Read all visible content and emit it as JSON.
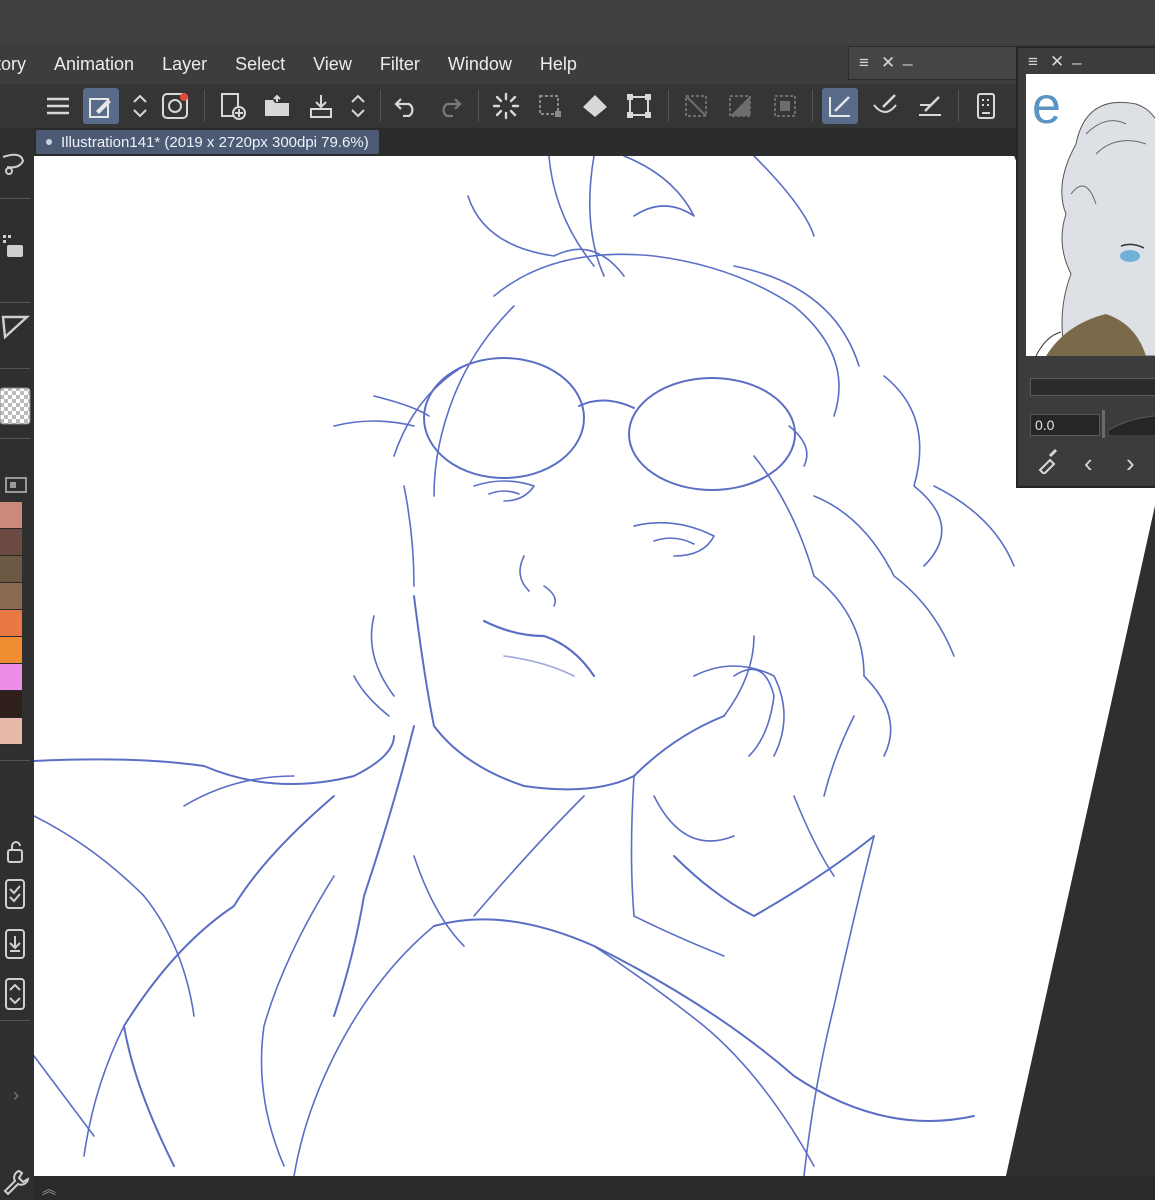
{
  "menu": {
    "items": [
      "tory",
      "Animation",
      "Layer",
      "Select",
      "View",
      "Filter",
      "Window",
      "Help"
    ]
  },
  "toolbar": {
    "icons": [
      "menu-icon",
      "eyedropper-pen-icon",
      "up-down-icon",
      "spiral-icon",
      "new-file-icon",
      "open-folder-icon",
      "export-icon",
      "up-down-icon",
      "undo-icon",
      "redo-icon",
      "loading-spinner-icon",
      "select-marquee-icon",
      "fill-bucket-icon",
      "transform-icon",
      "deselect-icon",
      "invert-selection-icon",
      "selection-frame-icon",
      "pen-pressure-icon",
      "brush-icon",
      "ruler-pen-icon",
      "device-icon"
    ]
  },
  "document": {
    "tab_title": "Illustration141* (2019 x 2720px 300dpi 79.6%)"
  },
  "palette": {
    "colors": [
      "#c98a7a",
      "#6c4a44",
      "#6b5944",
      "#8b6a50",
      "#e87944",
      "#f08c32",
      "#ec8de8",
      "#2e1f1b",
      "#e8b8a8"
    ]
  },
  "navigator": {
    "preview_letter": "e",
    "rotation_value": "0.0"
  },
  "sketch": {
    "stroke_color": "#4a5fbf"
  }
}
